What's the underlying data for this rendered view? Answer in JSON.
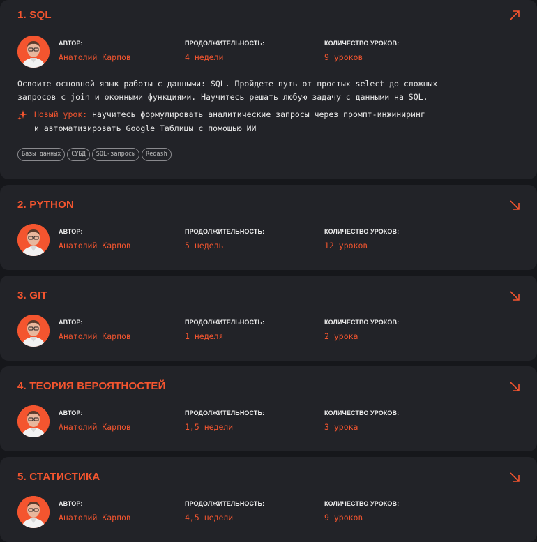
{
  "labels": {
    "author": "АВТОР:",
    "duration": "ПРОДОЛЖИТЕЛЬНОСТЬ:",
    "lessons": "КОЛИЧЕСТВО УРОКОВ:"
  },
  "icons": {
    "expanded": "arrow-up-right-icon",
    "collapsed": "arrow-down-right-icon",
    "sparkle": "sparkle-icon"
  },
  "colors": {
    "accent": "#f4552f",
    "card": "#222328",
    "background": "#16171b"
  },
  "courses": [
    {
      "title": "1. SQL",
      "author": "Анатолий Карпов",
      "duration": "4 недели",
      "lessons": "9 уроков",
      "description_line1": "Освоите основной язык работы с данными: SQL. Пройдете путь от простых select до сложных",
      "description_line2": "запросов с join и оконными функциями. Научитесь решать любую задачу с данными на SQL.",
      "new_lesson_label": "Новый урок:",
      "new_lesson_line1": " научитесь формулировать аналитические запросы через промпт-инжиниринг",
      "new_lesson_line2": "и автоматизировать Google Таблицы с помощью ИИ",
      "tags": [
        "Базы данных",
        "СУБД",
        "SQL-запросы",
        "Redash"
      ]
    },
    {
      "title": "2. PYTHON",
      "author": "Анатолий Карпов",
      "duration": "5 недель",
      "lessons": "12 уроков"
    },
    {
      "title": "3. GIT",
      "author": "Анатолий Карпов",
      "duration": "1 неделя",
      "lessons": "2 урока"
    },
    {
      "title": "4. ТЕОРИЯ ВЕРОЯТНОСТЕЙ",
      "author": "Анатолий Карпов",
      "duration": "1,5 недели",
      "lessons": "3 урока"
    },
    {
      "title": "5. СТАТИСТИКА",
      "author": "Анатолий Карпов",
      "duration": "4,5 недели",
      "lessons": "9 уроков"
    }
  ]
}
